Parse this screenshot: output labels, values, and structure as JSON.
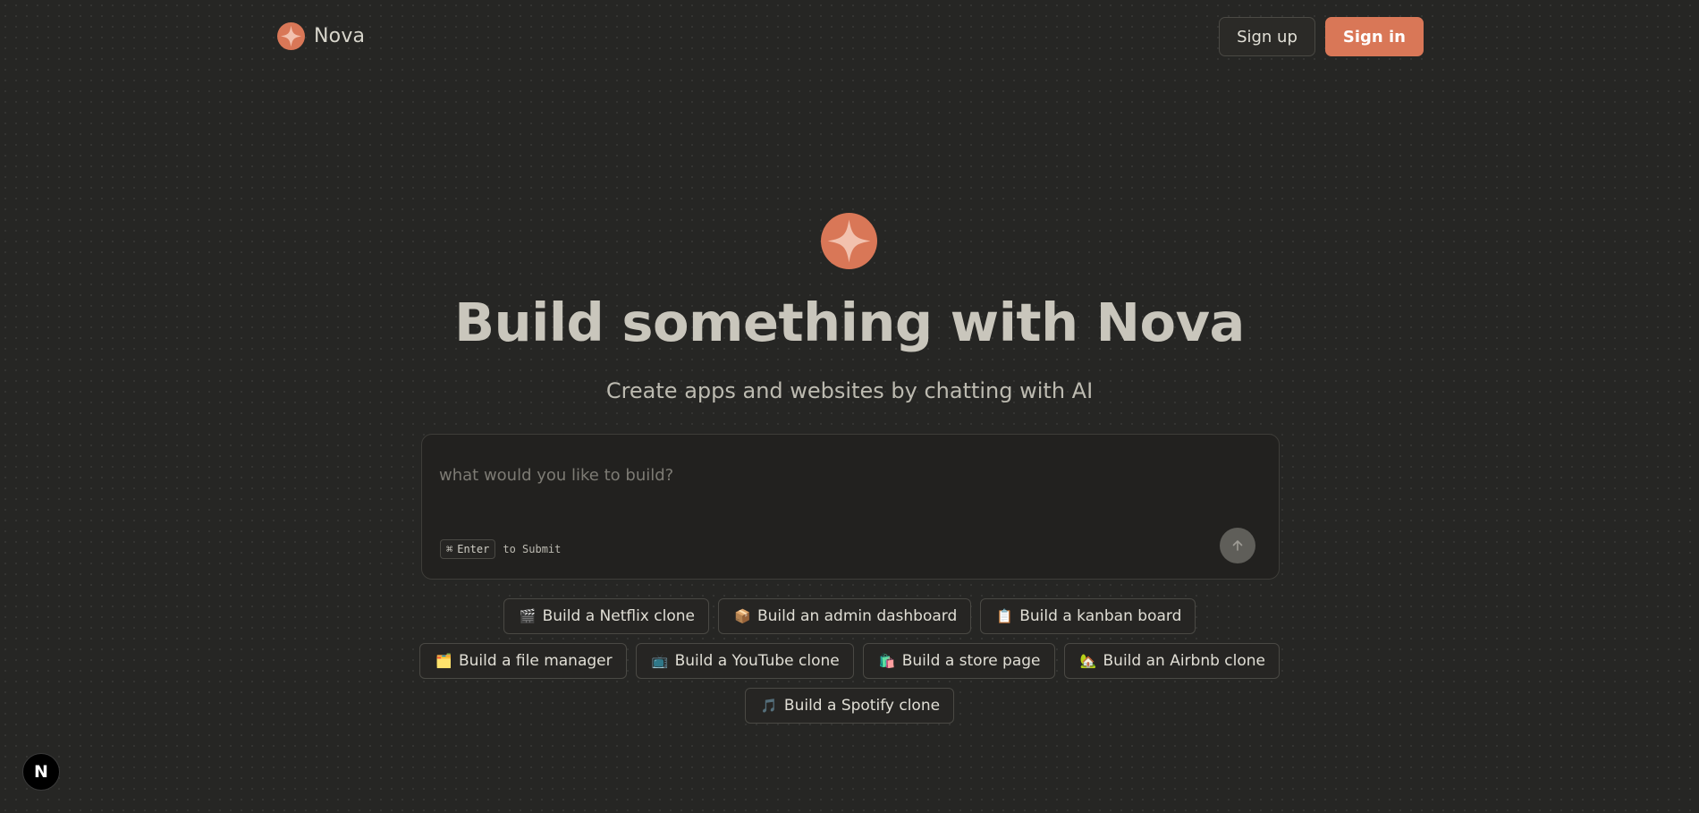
{
  "header": {
    "brand_name": "Nova",
    "logo_icon": "nova-star-icon",
    "signup_label": "Sign up",
    "signin_label": "Sign in"
  },
  "hero": {
    "title": "Build something with Nova",
    "subtitle": "Create apps and websites by chatting with AI"
  },
  "prompt": {
    "value": "",
    "placeholder": "what would you like to build?",
    "shortcut_key": "Enter",
    "shortcut_modifier": "⌘",
    "shortcut_suffix": "to Submit",
    "send_icon": "arrow-up-icon"
  },
  "suggestions": {
    "rows": [
      [
        {
          "icon": "🎬",
          "label": "Build a Netflix clone"
        },
        {
          "icon": "📦",
          "label": "Build an admin dashboard"
        },
        {
          "icon": "📋",
          "label": "Build a kanban board"
        }
      ],
      [
        {
          "icon": "🗂️",
          "label": "Build a file manager"
        },
        {
          "icon": "📺",
          "label": "Build a YouTube clone"
        },
        {
          "icon": "🛍️",
          "label": "Build a store page"
        },
        {
          "icon": "🏡",
          "label": "Build an Airbnb clone"
        }
      ],
      [
        {
          "icon": "🎵",
          "label": "Build a Spotify clone"
        }
      ]
    ]
  },
  "badge": {
    "letter": "N"
  },
  "colors": {
    "accent": "#d97757",
    "background": "#262624"
  }
}
